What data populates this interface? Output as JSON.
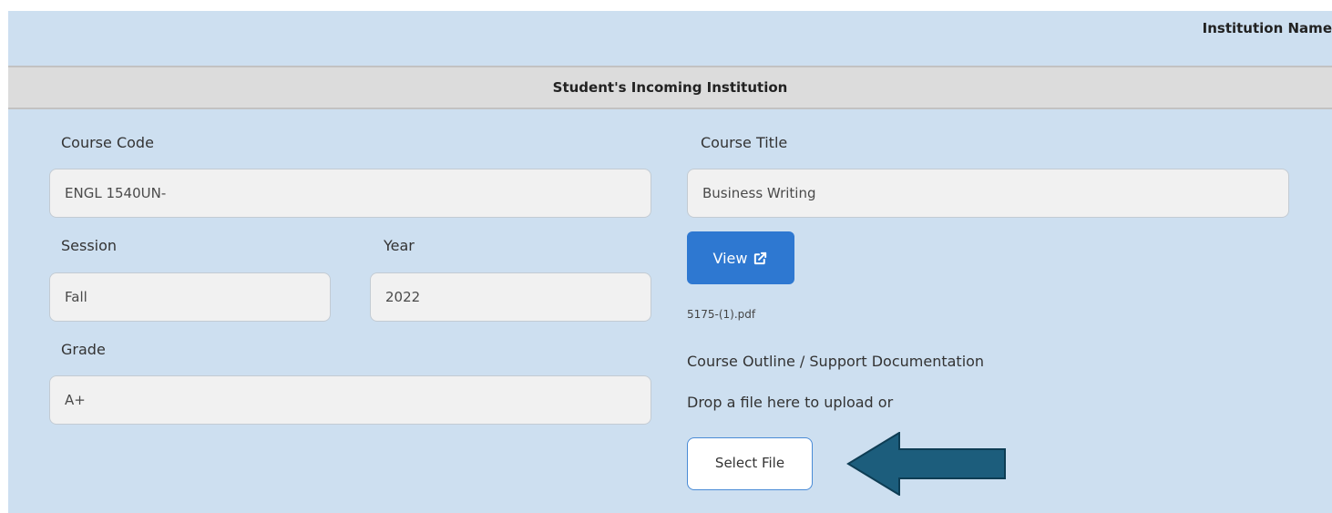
{
  "header": {
    "institution_name_label": "Institution Name"
  },
  "section": {
    "title": "Student's Incoming Institution"
  },
  "form": {
    "course_code": {
      "label": "Course Code",
      "value": "ENGL 1540UN-"
    },
    "course_title": {
      "label": "Course Title",
      "value": "Business Writing"
    },
    "session": {
      "label": "Session",
      "value": "Fall"
    },
    "year": {
      "label": "Year",
      "value": "2022"
    },
    "grade": {
      "label": "Grade",
      "value": "A+"
    }
  },
  "attachment": {
    "view_label": "View",
    "file_name": "5175-(1).pdf",
    "outline_label": "Course Outline / Support Documentation",
    "drop_text": "Drop a file here to upload or",
    "select_label": "Select File"
  },
  "icons": {
    "view": "external-link-icon",
    "pointer": "arrow-left-icon"
  },
  "colors": {
    "panel_bg": "#cddff0",
    "section_bg": "#dcdcdc",
    "view_button": "#2e78d1",
    "select_border": "#4a8bd6",
    "arrow": "#1c5d7c"
  }
}
